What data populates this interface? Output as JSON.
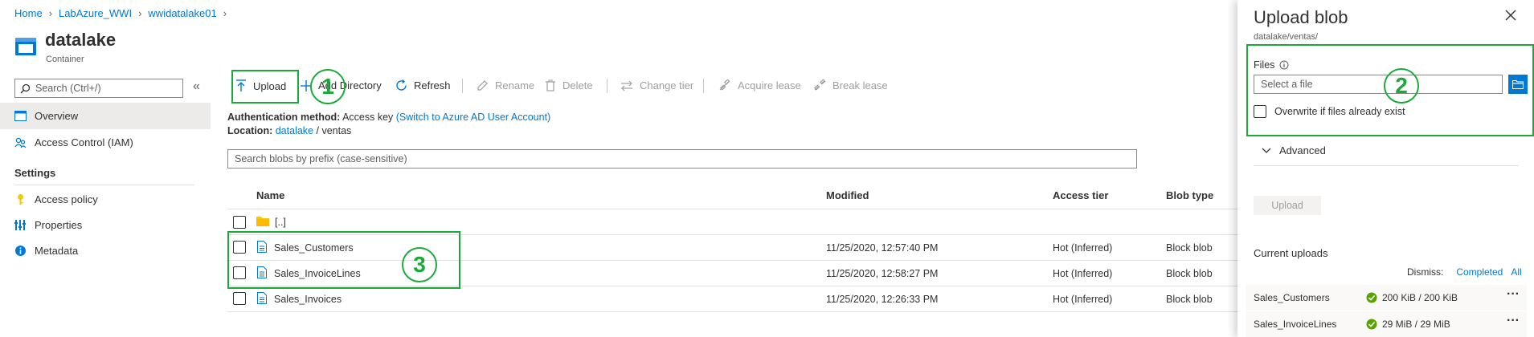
{
  "breadcrumb": [
    "Home",
    "LabAzure_WWI",
    "wwidatalake01"
  ],
  "resource": {
    "title": "datalake",
    "subtitle": "Container"
  },
  "sidebar": {
    "search_placeholder": "Search (Ctrl+/)",
    "items": [
      {
        "label": "Overview"
      },
      {
        "label": "Access Control (IAM)"
      }
    ],
    "section_title": "Settings",
    "settings_items": [
      {
        "label": "Access policy"
      },
      {
        "label": "Properties"
      },
      {
        "label": "Metadata"
      }
    ]
  },
  "toolbar": {
    "upload": "Upload",
    "add_directory": "Add Directory",
    "refresh": "Refresh",
    "rename": "Rename",
    "delete": "Delete",
    "change_tier": "Change tier",
    "acquire_lease": "Acquire lease",
    "break_lease": "Break lease"
  },
  "info": {
    "auth_label": "Authentication method:",
    "auth_value": "Access key",
    "auth_link": "(Switch to Azure AD User Account)",
    "location_label": "Location:",
    "location_link": "datalake",
    "location_sep": "/",
    "location_path": "ventas"
  },
  "search_blobs_placeholder": "Search blobs by prefix (case-sensitive)",
  "table": {
    "headers": [
      "Name",
      "Modified",
      "Access tier",
      "Blob type"
    ],
    "parent_row": "[..]",
    "rows": [
      {
        "name": "Sales_Customers",
        "modified": "11/25/2020, 12:57:40 PM",
        "tier": "Hot (Inferred)",
        "type": "Block blob"
      },
      {
        "name": "Sales_InvoiceLines",
        "modified": "11/25/2020, 12:58:27 PM",
        "tier": "Hot (Inferred)",
        "type": "Block blob"
      },
      {
        "name": "Sales_Invoices",
        "modified": "11/25/2020, 12:26:33 PM",
        "tier": "Hot (Inferred)",
        "type": "Block blob"
      }
    ]
  },
  "annotations": {
    "one": "1",
    "two": "2",
    "three": "3"
  },
  "panel": {
    "title": "Upload blob",
    "subtitle": "datalake/ventas/",
    "files_label": "Files",
    "file_placeholder": "Select a file",
    "overwrite_label": "Overwrite if files already exist",
    "advanced_label": "Advanced",
    "upload_button": "Upload",
    "current_uploads": "Current uploads",
    "dismiss_label": "Dismiss:",
    "dismiss_completed": "Completed",
    "dismiss_all": "All",
    "uploads": [
      {
        "name": "Sales_Customers",
        "progress": "200 KiB / 200 KiB"
      },
      {
        "name": "Sales_InvoiceLines",
        "progress": "29 MiB / 29 MiB"
      }
    ]
  },
  "colors": {
    "accent": "#0078d4",
    "annotation": "#1aaa3a",
    "success": "#57a300"
  }
}
